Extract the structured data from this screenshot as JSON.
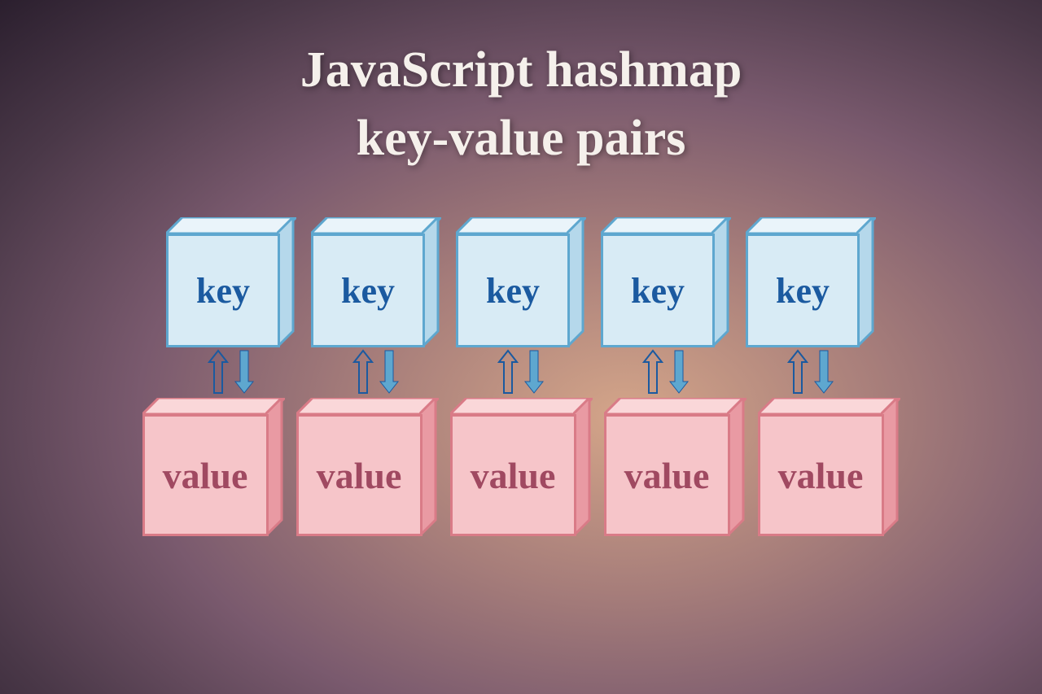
{
  "title_line1": "JavaScript hashmap",
  "title_line2": "key-value pairs",
  "keys": [
    "key",
    "key",
    "key",
    "key",
    "key"
  ],
  "values": [
    "value",
    "value",
    "value",
    "value",
    "value"
  ],
  "colors": {
    "key_front": "#d8ebf5",
    "key_border": "#5ea7cf",
    "key_text": "#1b5aa0",
    "value_front": "#f6c5c9",
    "value_border": "#d97b87",
    "value_text": "#a04961",
    "arrow_down": "#5ea7cf",
    "arrow_up_stroke": "#1b5aa0"
  }
}
